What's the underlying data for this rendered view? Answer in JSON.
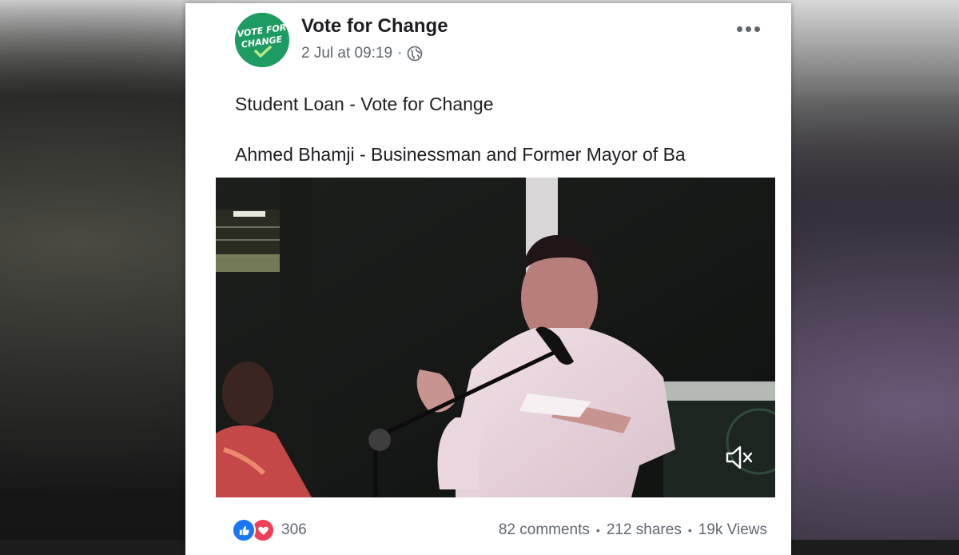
{
  "post": {
    "page_name": "Vote for Change",
    "timestamp": "2 Jul at 09:19",
    "separator": "·",
    "privacy_icon": "globe-icon",
    "more_icon": "more-options-icon",
    "avatar": {
      "line1": "VOTE FOR",
      "line2": "CHANGE",
      "color": "#1e9b63"
    },
    "text_lines": [
      "Student Loan - Vote for Change",
      "Ahmed Bhamji - Businessman and Former Mayor of Ba"
    ]
  },
  "video": {
    "mute_icon": "muted-speaker-icon"
  },
  "footer": {
    "reaction_count": "306",
    "reactions": [
      "like-icon",
      "love-icon"
    ],
    "comments": "82 comments",
    "shares": "212 shares",
    "views": "19k Views",
    "separator": "•"
  },
  "colors": {
    "like": "#1877f2",
    "love": "#f33e58",
    "text": "#1c1e21",
    "secondary": "#606770"
  }
}
